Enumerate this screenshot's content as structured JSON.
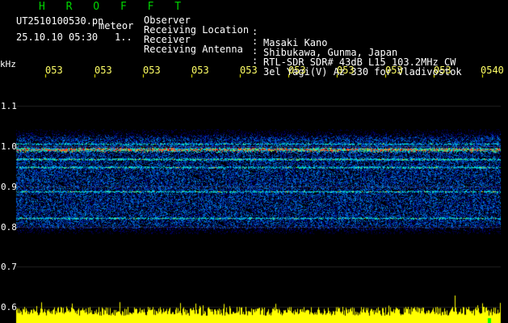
{
  "header": {
    "title": "H R O F F T",
    "filename": "UT2510100530.pn",
    "meteor_label": "meteor",
    "datetime": "25.10.10 05:30",
    "dots": "1.."
  },
  "info": [
    {
      "label": "Observer",
      "value": "Masaki Kano"
    },
    {
      "label": "Receiving Location",
      "value": "Shibukawa, Gunma, Japan"
    },
    {
      "label": "Receiver",
      "value": "RTL-SDR SDR# 43dB L15 103.2MHz CW"
    },
    {
      "label": "Receiving Antenna",
      "value": "3el Yagi(V) Az 330 for Vladivostok"
    }
  ],
  "axis": {
    "unit": "kHz",
    "y_ticks": [
      "1.1",
      "1.0",
      "0.9",
      "0.8",
      "0.7",
      "0.6"
    ],
    "time_labels": [
      "053",
      "053",
      "053",
      "053",
      "053",
      "053",
      "053",
      "053",
      "053",
      "0540"
    ]
  },
  "colors": {
    "background": "#000000",
    "title": "#00d400",
    "text": "#ffffff",
    "time_labels": "#ffff66",
    "amplitude": "#ffff00",
    "waterfall_base": "#0a1a8a",
    "echo_line": "#ff3030"
  }
}
